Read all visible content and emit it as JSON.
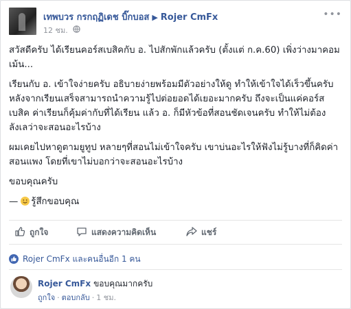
{
  "post": {
    "author": "เทพบวร กรกฤฏิเดช บิ๊กบอส",
    "target": "Rojer CmFx",
    "time": "12 ชม.",
    "paragraphs": [
      "สวัสดีครับ ได้เรียนคอร์สเบสิคกับ อ. ไปสักพักแล้วครับ (ตั้งแต่ ก.ค.60) เพิ่งว่างมาคอมเม้น...",
      "เรียนกับ อ. เข้าใจง่ายครับ อธิบายง่ายพร้อมมีตัวอย่างให้ดู ทำให้เข้าใจได้เร็วขึ้นครับ หลังจากเรียนเสร็จสามารถนำความรู้ไปต่อยอดได้เยอะมากครับ ถึงจะเป็นแค่คอร์สเบสิค ค่าเรียนก็คุ้มค่ากับที่ได้เรียน แล้ว อ. ก็มีหัวข้อที่สอนชัดเจนครับ ทำให้ไม่ต้องลังเลว่าจะสอนอะไรบ้าง",
      "ผมเคยไปหาดูตามยูทูป หลายๆที่สอนไม่เข้าใจครับ เขาบ่นอะไรให้ฟังไม่รู้บางที่ก็คิดค่าสอนแพง โดยที่เขาไม่บอกว่าจะสอนอะไรบ้าง",
      "ขอบคุณครับ"
    ],
    "feeling_prefix": "—",
    "feeling": "รู้สึกขอบคุณ"
  },
  "actions": {
    "like": "ถูกใจ",
    "comment": "แสดงความคิดเห็น",
    "share": "แชร์"
  },
  "likes_summary": "Rojer CmFx และคนอื่นอีก 1 คน",
  "comment": {
    "name": "Rojer CmFx",
    "text": "ขอบคุณมากครับ",
    "like": "ถูกใจ",
    "reply": "ตอบกลับ",
    "time": "1 ชม."
  },
  "colors": {
    "link": "#365899",
    "brand": "#4267b2",
    "muted": "#90949c"
  }
}
